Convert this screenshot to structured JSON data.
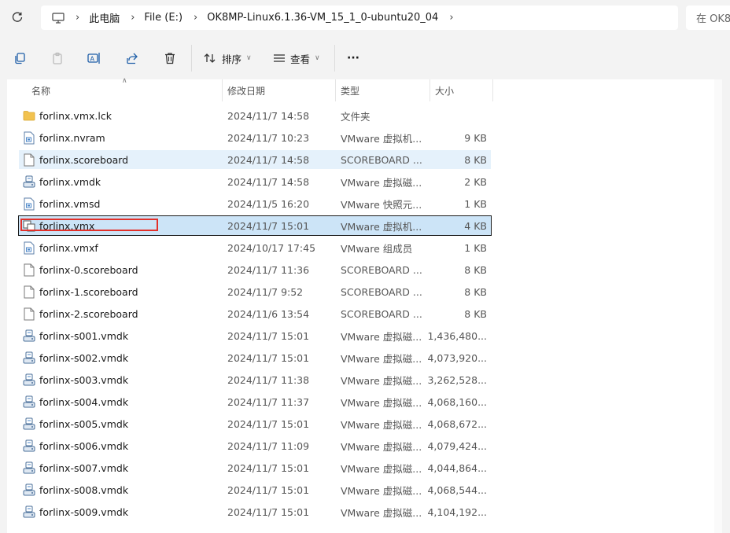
{
  "address": {
    "breadcrumbs": [
      "此电脑",
      "File (E:)",
      "OK8MP-Linux6.1.36-VM_15_1_0-ubuntu20_04"
    ],
    "search_placeholder": "在 OK8"
  },
  "toolbar": {
    "sort_label": "排序",
    "view_label": "查看",
    "more_label": "···"
  },
  "columns": {
    "name": "名称",
    "date": "修改日期",
    "type": "类型",
    "size": "大小"
  },
  "files": [
    {
      "name": "forlinx.vmx.lck",
      "date": "2024/11/7 14:58",
      "type": "文件夹",
      "size": "",
      "icon": "folder-icon"
    },
    {
      "name": "forlinx.nvram",
      "date": "2024/11/7 10:23",
      "type": "VMware 虚拟机...",
      "size": "9 KB",
      "icon": "vm-file-icon"
    },
    {
      "name": "forlinx.scoreboard",
      "date": "2024/11/7 14:58",
      "type": "SCOREBOARD ...",
      "size": "8 KB",
      "icon": "blank-file-icon"
    },
    {
      "name": "forlinx.vmdk",
      "date": "2024/11/7 14:58",
      "type": "VMware 虚拟磁...",
      "size": "2 KB",
      "icon": "disk-icon"
    },
    {
      "name": "forlinx.vmsd",
      "date": "2024/11/5 16:20",
      "type": "VMware 快照元...",
      "size": "1 KB",
      "icon": "vm-file-icon"
    },
    {
      "name": "forlinx.vmx",
      "date": "2024/11/7 15:01",
      "type": "VMware 虚拟机...",
      "size": "4 KB",
      "icon": "vmx-icon"
    },
    {
      "name": "forlinx.vmxf",
      "date": "2024/10/17 17:45",
      "type": "VMware 组成员",
      "size": "1 KB",
      "icon": "vm-file-icon"
    },
    {
      "name": "forlinx-0.scoreboard",
      "date": "2024/11/7 11:36",
      "type": "SCOREBOARD ...",
      "size": "8 KB",
      "icon": "blank-file-icon"
    },
    {
      "name": "forlinx-1.scoreboard",
      "date": "2024/11/7 9:52",
      "type": "SCOREBOARD ...",
      "size": "8 KB",
      "icon": "blank-file-icon"
    },
    {
      "name": "forlinx-2.scoreboard",
      "date": "2024/11/6 13:54",
      "type": "SCOREBOARD ...",
      "size": "8 KB",
      "icon": "blank-file-icon"
    },
    {
      "name": "forlinx-s001.vmdk",
      "date": "2024/11/7 15:01",
      "type": "VMware 虚拟磁...",
      "size": "1,436,480...",
      "icon": "disk-icon"
    },
    {
      "name": "forlinx-s002.vmdk",
      "date": "2024/11/7 15:01",
      "type": "VMware 虚拟磁...",
      "size": "4,073,920...",
      "icon": "disk-icon"
    },
    {
      "name": "forlinx-s003.vmdk",
      "date": "2024/11/7 11:38",
      "type": "VMware 虚拟磁...",
      "size": "3,262,528...",
      "icon": "disk-icon"
    },
    {
      "name": "forlinx-s004.vmdk",
      "date": "2024/11/7 11:37",
      "type": "VMware 虚拟磁...",
      "size": "4,068,160...",
      "icon": "disk-icon"
    },
    {
      "name": "forlinx-s005.vmdk",
      "date": "2024/11/7 15:01",
      "type": "VMware 虚拟磁...",
      "size": "4,068,672...",
      "icon": "disk-icon"
    },
    {
      "name": "forlinx-s006.vmdk",
      "date": "2024/11/7 11:09",
      "type": "VMware 虚拟磁...",
      "size": "4,079,424...",
      "icon": "disk-icon"
    },
    {
      "name": "forlinx-s007.vmdk",
      "date": "2024/11/7 15:01",
      "type": "VMware 虚拟磁...",
      "size": "4,044,864...",
      "icon": "disk-icon"
    },
    {
      "name": "forlinx-s008.vmdk",
      "date": "2024/11/7 15:01",
      "type": "VMware 虚拟磁...",
      "size": "4,068,544...",
      "icon": "disk-icon"
    },
    {
      "name": "forlinx-s009.vmdk",
      "date": "2024/11/7 15:01",
      "type": "VMware 虚拟磁...",
      "size": "4,104,192...",
      "icon": "disk-icon"
    }
  ],
  "hover_row": 2,
  "selected_row": 5,
  "colors": {
    "accent": "#1f5fa8",
    "selected": "#cce4f7",
    "hover": "#e5f1fb",
    "annotation": "#e2302a",
    "folder": "#f2c24f"
  }
}
